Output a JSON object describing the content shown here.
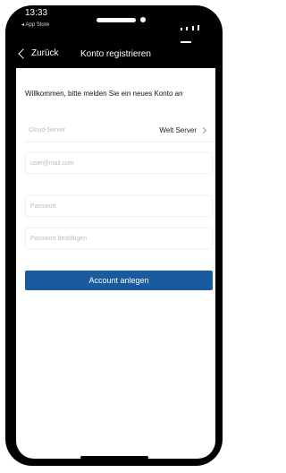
{
  "status_bar": {
    "time": "13:33",
    "back_app": "◂ App Store"
  },
  "nav": {
    "back_label": "Zurück",
    "title": "Konto registrieren"
  },
  "welcome_text": "Willkommen, bitte melden Sie ein neues Konto an",
  "cloud_server": {
    "label": "Cloud-Server",
    "value": "Welt Server"
  },
  "fields": {
    "email_placeholder": "user@mail.com",
    "password_placeholder": "Passwort",
    "password_confirm_placeholder": "Passwort bestätigen"
  },
  "submit_label": "Account anlegen",
  "colors": {
    "accent": "#1a5a9e"
  }
}
